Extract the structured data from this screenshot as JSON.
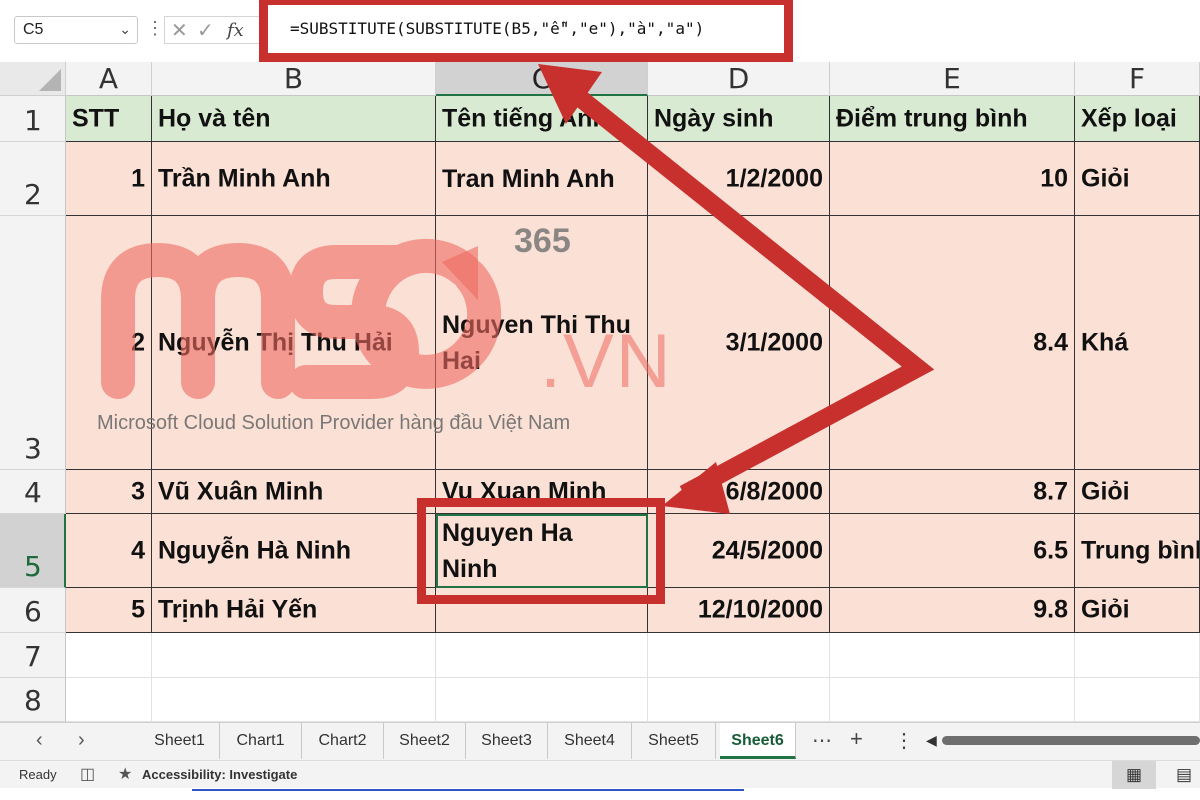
{
  "formula_bar": {
    "name_box": "C5",
    "formula": "=SUBSTITUTE(SUBSTITUTE(B5,\"ễ\",\"e\"),\"à\",\"a\")"
  },
  "columns": [
    "A",
    "B",
    "C",
    "D",
    "E",
    "F"
  ],
  "rows": [
    "1",
    "2",
    "3",
    "4",
    "5",
    "6",
    "7",
    "8"
  ],
  "table": {
    "headers": [
      "STT",
      "Họ và tên",
      "Tên tiếng Anh",
      "Ngày sinh",
      "Điểm trung bình",
      "Xếp loại"
    ],
    "data": [
      [
        "1",
        "Trần Minh Anh",
        "Tran Minh Anh",
        "1/2/2000",
        "10",
        "Giỏi"
      ],
      [
        "2",
        "Nguyễn Thị Thu Hải",
        "Nguyen Thi Thu Hai",
        "3/1/2000",
        "8.4",
        "Khá"
      ],
      [
        "3",
        "Vũ Xuân Minh",
        "Vu Xuan Minh",
        "16/8/2000",
        "8.7",
        "Giỏi"
      ],
      [
        "4",
        "Nguyễn Hà Ninh",
        "Nguyen Ha Ninh",
        "24/5/2000",
        "6.5",
        "Trung bình"
      ],
      [
        "5",
        "Trịnh Hải Yến",
        "",
        "12/10/2000",
        "9.8",
        "Giỏi"
      ]
    ]
  },
  "sheet_tabs": [
    "Sheet1",
    "Chart1",
    "Chart2",
    "Sheet2",
    "Sheet3",
    "Sheet4",
    "Sheet5",
    "Sheet6"
  ],
  "active_sheet": "Sheet6",
  "status_bar": {
    "ready": "Ready",
    "accessibility": "Accessibility: Investigate"
  },
  "watermark": {
    "brand": "365",
    "suffix": ".VN",
    "tagline": "Microsoft Cloud Solution Provider hàng đầu Việt Nam"
  },
  "colors": {
    "annotation": "#c8302e",
    "header_fill": "#d9ead3",
    "data_fill": "#fbe0d5",
    "excel_green": "#217346"
  },
  "icons": [
    "chevron-down-icon",
    "cancel-icon",
    "enter-icon",
    "function-icon",
    "more-icon",
    "add-sheet-icon",
    "page-layout-icon",
    "accessibility-icon",
    "normal-view-icon",
    "page-view-icon"
  ]
}
